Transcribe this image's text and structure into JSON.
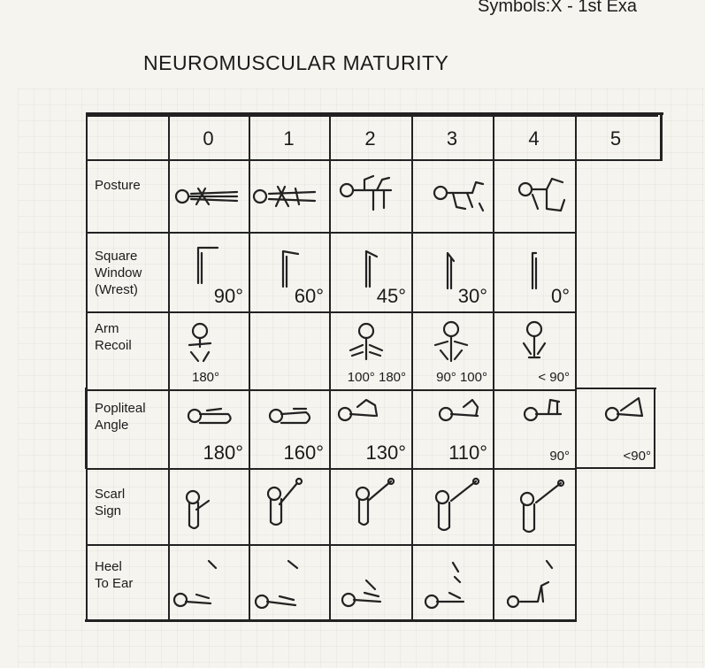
{
  "header": {
    "symbols_text": "Symbols:X - 1st Exa"
  },
  "title": "NEUROMUSCULAR MATURITY",
  "table": {
    "columns": [
      "0",
      "1",
      "2",
      "3",
      "4",
      "5"
    ],
    "rows": [
      {
        "label": "Posture",
        "values": [
          "",
          "",
          "",
          "",
          "",
          ""
        ]
      },
      {
        "label": "Square\nWindow\n(Wrest)",
        "values": [
          "90°",
          "60°",
          "45°",
          "30°",
          "0°",
          ""
        ]
      },
      {
        "label": "Arm\nRecoil",
        "values": [
          "180°",
          "",
          "100° 180°",
          "90° 100°",
          "<  90°",
          ""
        ]
      },
      {
        "label": "Popliteal\nAngle",
        "values": [
          "180°",
          "160°",
          "130°",
          "110°",
          "90°",
          "<90°"
        ]
      },
      {
        "label": "Scarl\nSign",
        "values": [
          "",
          "",
          "",
          "",
          "",
          ""
        ]
      },
      {
        "label": "Heel\nTo Ear",
        "values": [
          "",
          "",
          "",
          "",
          "",
          ""
        ]
      }
    ]
  }
}
